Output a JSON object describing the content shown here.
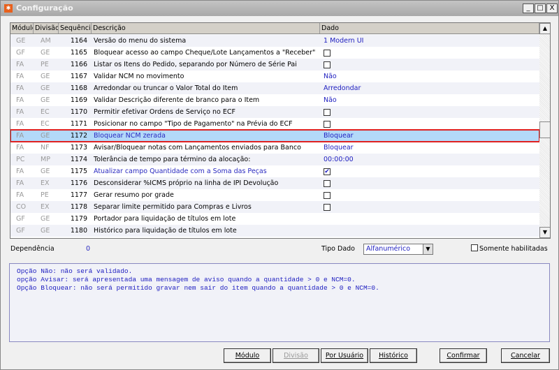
{
  "window": {
    "title": "Configuração",
    "minimize": "_",
    "maximize": "□",
    "close": "X"
  },
  "grid": {
    "headers": [
      "Módulo",
      "Divisão",
      "Sequência",
      "Descrição",
      "Dado"
    ],
    "rows": [
      {
        "modulo": "GE",
        "divisao": "AM",
        "seq": "1164",
        "desc": "Versão do menu do sistema",
        "dado": "1 Modern UI",
        "type": "text"
      },
      {
        "modulo": "GF",
        "divisao": "GE",
        "seq": "1165",
        "desc": "Bloquear acesso ao campo Cheque/Lote Lançamentos a \"Receber\"",
        "dado": "",
        "type": "checkbox",
        "checked": false
      },
      {
        "modulo": "FA",
        "divisao": "PE",
        "seq": "1166",
        "desc": "Listar os Itens do Pedido, separando por Número de Série Pai",
        "dado": "",
        "type": "checkbox",
        "checked": false
      },
      {
        "modulo": "FA",
        "divisao": "GE",
        "seq": "1167",
        "desc": "Validar NCM no movimento",
        "dado": "Não",
        "type": "text"
      },
      {
        "modulo": "FA",
        "divisao": "GE",
        "seq": "1168",
        "desc": "Arredondar ou truncar o Valor Total do Item",
        "dado": "Arredondar",
        "type": "text"
      },
      {
        "modulo": "FA",
        "divisao": "GE",
        "seq": "1169",
        "desc": "Validar Descrição diferente de branco para o Item",
        "dado": "Não",
        "type": "text"
      },
      {
        "modulo": "FA",
        "divisao": "EC",
        "seq": "1170",
        "desc": "Permitir efetivar Ordens de Serviço no ECF",
        "dado": "",
        "type": "checkbox",
        "checked": false
      },
      {
        "modulo": "FA",
        "divisao": "EC",
        "seq": "1171",
        "desc": "Posicionar no campo \"Tipo de Pagamento\" na Prévia do ECF",
        "dado": "",
        "type": "checkbox",
        "checked": false
      },
      {
        "modulo": "FA",
        "divisao": "GE",
        "seq": "1172",
        "desc": "Bloquear NCM zerada",
        "dado": "Bloquear",
        "type": "text",
        "selected": true,
        "highlight": true
      },
      {
        "modulo": "FA",
        "divisao": "NF",
        "seq": "1173",
        "desc": "Avisar/Bloquear notas com Lançamentos enviados para Banco",
        "dado": "Bloquear",
        "type": "text"
      },
      {
        "modulo": "PC",
        "divisao": "MP",
        "seq": "1174",
        "desc": "Tolerância de tempo para término da alocação:",
        "dado": "00:00:00",
        "type": "text"
      },
      {
        "modulo": "FA",
        "divisao": "GE",
        "seq": "1175",
        "desc": "Atualizar campo Quantidade com a Soma das Peças",
        "dado": "",
        "type": "checkbox",
        "checked": true,
        "highlight": true
      },
      {
        "modulo": "FA",
        "divisao": "EX",
        "seq": "1176",
        "desc": "Desconsiderar %ICMS próprio na linha de IPI Devolução",
        "dado": "",
        "type": "checkbox",
        "checked": false
      },
      {
        "modulo": "FA",
        "divisao": "PE",
        "seq": "1177",
        "desc": "Gerar resumo por grade",
        "dado": "",
        "type": "checkbox",
        "checked": false
      },
      {
        "modulo": "CO",
        "divisao": "EX",
        "seq": "1178",
        "desc": "Separar limite permitido para Compras e Livros",
        "dado": "",
        "type": "checkbox",
        "checked": false
      },
      {
        "modulo": "GF",
        "divisao": "GE",
        "seq": "1179",
        "desc": "Portador para liquidação de títulos em lote",
        "dado": "",
        "type": "empty"
      },
      {
        "modulo": "GF",
        "divisao": "GE",
        "seq": "1180",
        "desc": "Histórico para liquidação de títulos em lote",
        "dado": "",
        "type": "empty"
      }
    ]
  },
  "footer": {
    "dependencia_label": "Dependência",
    "dependencia_value": "0",
    "tipo_dado_label": "Tipo Dado",
    "tipo_dado_value": "Alfanumérico",
    "somente_label": "Somente habilitadas",
    "memo": [
      "Opção Não: não será validado.",
      "opção Avisar: será apresentada uma mensagem de aviso quando a quantidade > 0 e NCM=0.",
      "Opção Bloquear: não será permitido gravar nem sair do item quando a quantidade > 0 e NCM=0."
    ]
  },
  "buttons": {
    "modulo": "Módulo",
    "divisao": "Divisão",
    "por_usuario": "Por Usuário",
    "historico": "Histórico",
    "confirmar": "Confirmar",
    "cancelar": "Cancelar"
  },
  "colors": {
    "selection": "#b3d9f9",
    "highlight_border": "#e02020",
    "value_text": "#2020c0"
  }
}
